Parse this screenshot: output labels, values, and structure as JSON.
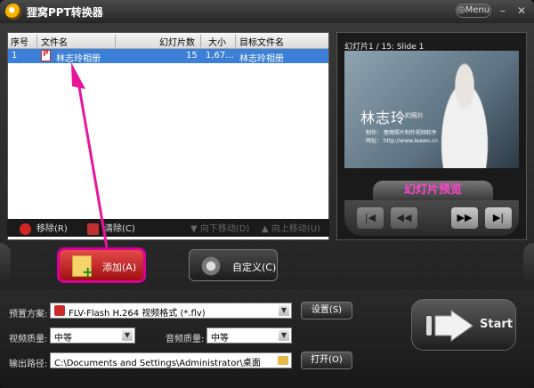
{
  "app": {
    "title": "狸窝PPT转换器",
    "menu_label": "Menu"
  },
  "window_controls": {
    "minimize": "–",
    "close": "✕"
  },
  "file_list": {
    "columns": [
      "序号",
      "文件名",
      "幻灯片数",
      "大小",
      "目标文件名"
    ],
    "rows": [
      {
        "index": "1",
        "filename": "林志玲相册",
        "slides": "15",
        "size": "1,67...",
        "target": "林志玲相册"
      }
    ]
  },
  "list_toolbar": {
    "remove": "移除(R)",
    "clear": "清除(C)",
    "move_down": "向下移动(D)",
    "move_up": "向上移动(U)"
  },
  "preview": {
    "label": "幻灯片1 / 15: Slide 1",
    "slide_title": "林志玲",
    "slide_subtitle": "的照片",
    "slide_line1": "制作：  狸窝照片制作视频软件",
    "slide_line2": "网址：  http://www.leawo.cn",
    "caption": "幻灯片预览"
  },
  "buttons": {
    "add": "添加(A)",
    "custom": "自定义(C)",
    "settings": "设置(S)",
    "open": "打开(O)",
    "start": "Start"
  },
  "form": {
    "preset_label": "预置方案:",
    "preset_value": "FLV-Flash H.264 视频格式 (*.flv)",
    "video_quality_label": "视频质量:",
    "video_quality_value": "中等",
    "audio_quality_label": "音频质量:",
    "audio_quality_value": "中等",
    "output_label": "输出路径:",
    "output_value": "C:\\Documents and Settings\\Administrator\\桌面"
  },
  "colors": {
    "selection": "#3b7fd6",
    "annotation": "#e8159b",
    "caption": "#ff44cc"
  }
}
